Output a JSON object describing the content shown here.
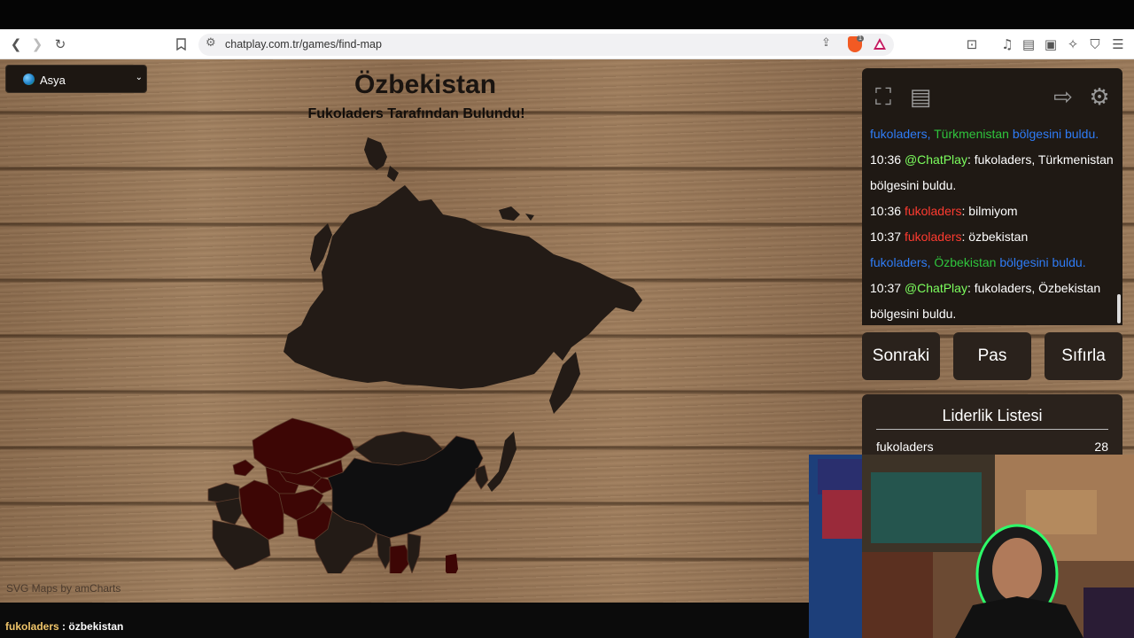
{
  "browser": {
    "url": "chatplay.com.tr/games/find-map",
    "icons": [
      "back-icon",
      "forward-icon",
      "reload-icon",
      "bookmark-icon",
      "site-settings-icon",
      "share-icon",
      "brave-shield-icon",
      "brave-rewards-icon",
      "leo-icon",
      "music-icon",
      "sidebar-icon",
      "wallet-icon",
      "ai-icon",
      "vpn-icon",
      "menu-icon"
    ],
    "shield_badge": "1"
  },
  "game": {
    "region_select": {
      "value": "Asya"
    },
    "country_title": "Özbekistan",
    "found_by": "Fukoladers Tarafından Bulundu!",
    "credit": "SVG Maps by amCharts",
    "colors": {
      "found": "#3d0605",
      "unfound": "#231b16",
      "highlighted": "#0f0f10",
      "wood": "#92714f"
    }
  },
  "chat": {
    "messages": [
      {
        "user": "fukoladers,",
        "country": "Türkmenistan",
        "text": "bölgesini buldu."
      },
      {
        "time": "10:36",
        "user": "@ChatPlay",
        "text": ": fukoladers, Türkmenistan bölgesini buldu."
      },
      {
        "time": "10:36",
        "user": "fukoladers",
        "text": ": bilmiyom"
      },
      {
        "time": "10:37",
        "user": "fukoladers",
        "text": ": özbekistan"
      },
      {
        "user": "fukoladers,",
        "country": "Özbekistan",
        "text": "bölgesini buldu."
      },
      {
        "time": "10:37",
        "user": "@ChatPlay",
        "text": ": fukoladers, Özbekistan bölgesini buldu."
      }
    ]
  },
  "buttons": {
    "next": "Sonraki",
    "pass": "Pas",
    "reset": "Sıfırla"
  },
  "leaderboard": {
    "title": "Liderlik Listesi",
    "rows": [
      {
        "name": "fukoladers",
        "score": "28"
      }
    ]
  },
  "bottom": {
    "user": "fukoladers",
    "sep": " : ",
    "message": "özbekistan"
  }
}
